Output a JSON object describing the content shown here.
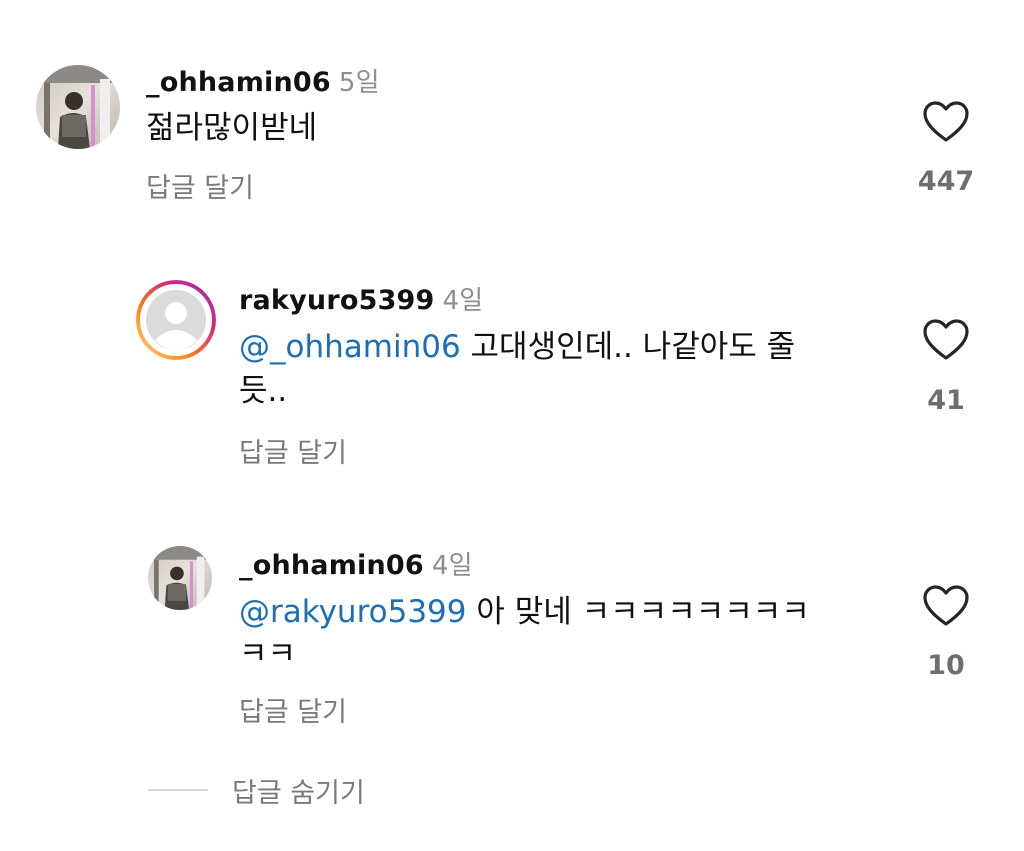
{
  "comments": [
    {
      "username": "_ohhamin06",
      "time": "5일",
      "text": "젊라많이받네",
      "reply_label": "답글 달기",
      "likes": "447",
      "avatar": "photo-avatar"
    },
    {
      "username": "rakyuro5399",
      "time": "4일",
      "mention": "@_ohhamin06",
      "text_line1": " 고대생인데.. 나같아도 줄",
      "text_line2": "듯..",
      "reply_label": "답글 달기",
      "likes": "41",
      "avatar": "default-avatar-with-story-ring"
    },
    {
      "username": "_ohhamin06",
      "time": "4일",
      "mention": "@rakyuro5399",
      "text_line1": " 아 맞네 ㅋㅋㅋㅋㅋㅋㅋㅋ",
      "text_line2": "ㅋㅋ",
      "reply_label": "답글 달기",
      "likes": "10",
      "avatar": "photo-avatar"
    }
  ],
  "hide_replies_label": "답글 숨기기",
  "icons": {
    "like": "heart-outline-icon"
  },
  "colors": {
    "mention": "#1d6fb5",
    "secondary_text": "#8e8e8e",
    "story_ring_start": "#f9a03f",
    "story_ring_end": "#d62976"
  }
}
